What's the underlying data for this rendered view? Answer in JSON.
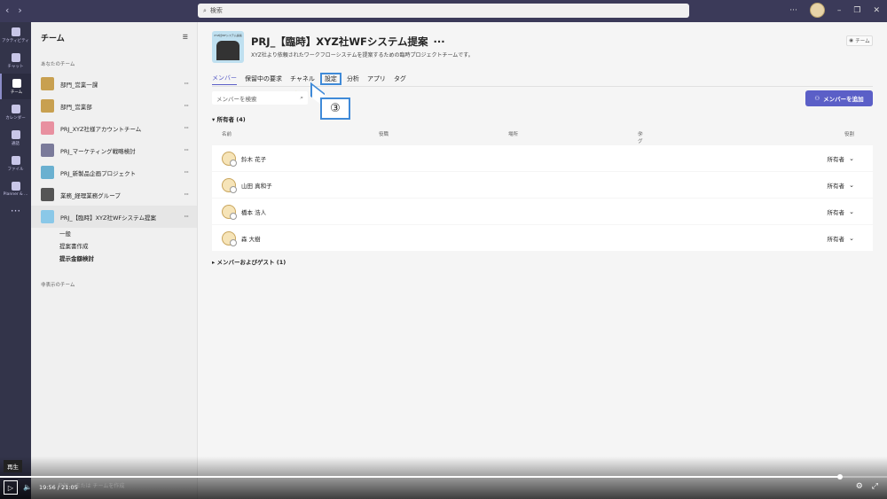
{
  "search": {
    "placeholder": "検索"
  },
  "rail": [
    {
      "label": "アクティビティ"
    },
    {
      "label": "チャット"
    },
    {
      "label": "チーム"
    },
    {
      "label": "カレンダー"
    },
    {
      "label": "通話"
    },
    {
      "label": "ファイル"
    },
    {
      "label": "Planner & ..."
    }
  ],
  "sidebar": {
    "title": "チーム",
    "section": "あなたのチーム",
    "teams": [
      {
        "name": "部門_営業一課",
        "color": "#c8a050"
      },
      {
        "name": "部門_営業部",
        "color": "#c8a050"
      },
      {
        "name": "PRJ_XYZ社様アカウントチーム",
        "color": "#e890a0"
      },
      {
        "name": "PRJ_マーケティング戦略検討",
        "color": "#7a7a9a"
      },
      {
        "name": "PRJ_新製品企画プロジェクト",
        "color": "#6ab0d0"
      },
      {
        "name": "業務_経理業務グループ",
        "color": "#555555"
      },
      {
        "name": "PRJ_【臨時】XYZ社WFシステム提案",
        "color": "#8ac8e8"
      }
    ],
    "channels": [
      "一般",
      "提案書作成",
      "提示金額検討"
    ],
    "hidden": "非表示のチーム"
  },
  "team": {
    "logo_text": "XYZ社WFシステム提案",
    "title": "PRJ_【臨時】XYZ社WFシステム提案",
    "more": "···",
    "description": "XYZ社より依頼されたワークフローシステムを提案するための臨時プロジェクトチームです。",
    "badge": "チーム"
  },
  "tabs": [
    "メンバー",
    "保留中の要求",
    "チャネル",
    "設定",
    "分析",
    "アプリ",
    "タグ"
  ],
  "callout": "③",
  "member_search": {
    "placeholder": "メンバーを検索"
  },
  "add_member": "メンバーを追加",
  "owners_section": "所有者 (4)",
  "columns": {
    "name": "名前",
    "title": "役職",
    "location": "場所",
    "tags": "タグ",
    "role": "役割"
  },
  "members": [
    {
      "name": "鈴木 花子",
      "role": "所有者"
    },
    {
      "name": "山田 真和子",
      "role": "所有者"
    },
    {
      "name": "橋本 浩人",
      "role": "所有者"
    },
    {
      "name": "森 大樹",
      "role": "所有者"
    }
  ],
  "guests_section": "メンバーおよびゲスト (1)",
  "player": {
    "tooltip": "再生",
    "time": "19:56 / 21:05",
    "progress": 0.947,
    "bottom_text": "参加... または チームを作成"
  }
}
